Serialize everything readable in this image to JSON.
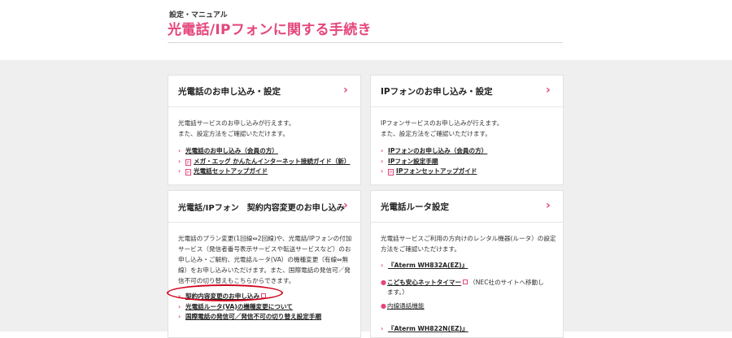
{
  "header": {
    "breadcrumb": "設定・マニュアル",
    "title": "光電話/IPフォンに関する手続き"
  },
  "cards": {
    "hikari_apply": {
      "title": "光電話のお申し込み・設定",
      "desc1": "光電話サービスのお申し込みが行えます。",
      "desc2": "また、設定方法をご確認いただけます。",
      "link1": "光電話のお申し込み（会員の方）",
      "link2": "メガ・エッグ かんたんインターネット接続ガイド（新）",
      "link3": "光電話セットアップガイド"
    },
    "ip_apply": {
      "title": "IPフォンのお申し込み・設定",
      "desc1": "IPフォンサービスのお申し込みが行えます。",
      "desc2": "また、設定方法をご確認いただけます。",
      "link1": "IPフォンのお申し込み（会員の方）",
      "link2": "IPフォン設定手順",
      "link3": "IPフォンセットアップガイド"
    },
    "contract_change": {
      "title": "光電話/IPフォン　契約内容変更のお申し込み",
      "desc1": "光電話のプラン変更(1回線⇔2回線)や、光電話/IPフォンの付加",
      "desc2": "サービス（発信者番号表示サービスや転送サービスなど）のお",
      "desc3": "申し込み・ご解約、光電話ルータ(VA）の機種変更（有線⇔無",
      "desc4": "線）をお申し込みいただけます。また、国際電話の発信可／発",
      "desc5": "信不可の切り替えもこちらからできます。",
      "link1": "契約内容変更のお申し込み",
      "link2": "光電話ルータ(VA)の機種変更について",
      "link3": "国際電話の発信可／発信不可の切り替え設定手順"
    },
    "router": {
      "title": "光電話ルータ設定",
      "desc1": "光電話サービスご利用の方向けのレンタル機器(ルータ）の設定",
      "desc2": "方法をご確認いただけます。",
      "model1": "『Aterm WH832A(EZ)』",
      "sub1": "こども安心ネットタイマー",
      "sub1_note": "（NEC社のサイトへ移動し",
      "sub1_note2": "ます。）",
      "sub2": "内線通話機能",
      "model2": "『Aterm WH822N(EZ)』"
    }
  },
  "colors": {
    "accent": "#e4467a",
    "highlight": "#d0021b",
    "background": "#efefef"
  },
  "icons": [
    "chevron-right-icon",
    "arrow-right-icon",
    "pdf-icon",
    "external-link-icon"
  ]
}
